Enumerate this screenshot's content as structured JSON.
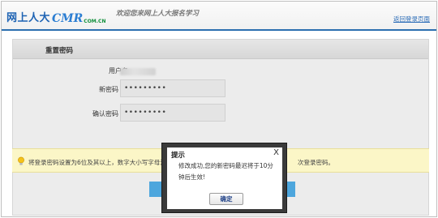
{
  "header": {
    "logo_text": "网上人大",
    "logo_cmr": "CMR",
    "logo_cn": "COM.CN",
    "welcome": "欢迎您来网上人大报名学习",
    "return_link": "返回登录页面"
  },
  "panel": {
    "title": "重置密码",
    "username_label": "用户名",
    "new_password_label": "新密码",
    "new_password_value": "•••••••••",
    "confirm_password_label": "确认密码",
    "confirm_password_value": "•••••••••"
  },
  "tip": {
    "left_text": "将登录密码设置为6位及其以上，数字大小写字母混合",
    "right_text": "次登录密码。"
  },
  "modal": {
    "title": "提示",
    "close": "X",
    "message": "修改成功,您的新密码最迟将于10分钟后生效!",
    "ok_label": "确定"
  },
  "colors": {
    "brand_blue": "#1e63b3",
    "tip_bg": "#fbf6c7",
    "button_blue": "#4da6dd"
  }
}
